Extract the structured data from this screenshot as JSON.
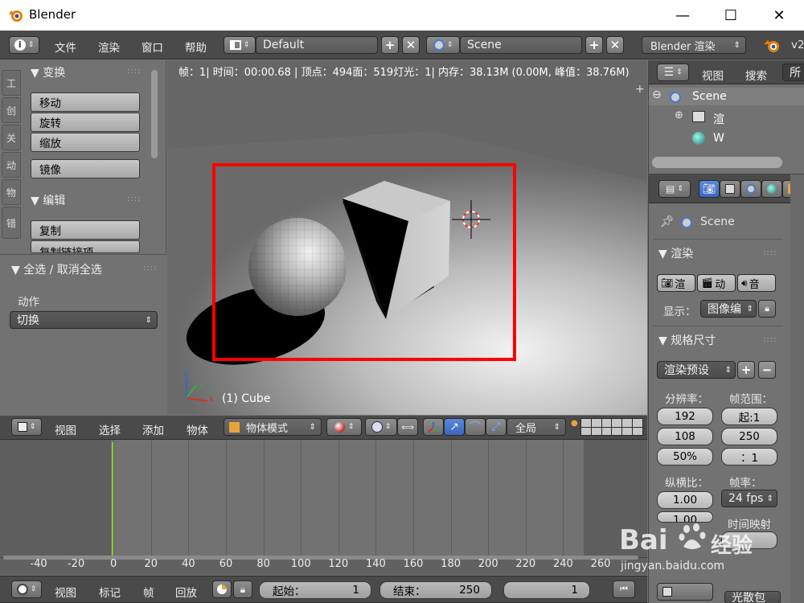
{
  "window": {
    "title": "Blender",
    "minimize": "—",
    "maximize": "☐",
    "close": "✕"
  },
  "infobar": {
    "menus": [
      "文件",
      "渲染",
      "窗口",
      "帮助"
    ],
    "layout": "Default",
    "scene": "Scene",
    "engine": "Blender 渲染",
    "version_fragment": "v2"
  },
  "viewport": {
    "stats": "帧：1| 时间：00:00.68 | 顶点：494面：519灯光：1| 内存：38.13M (0.00M, 峰值：38.76M)",
    "object_label": "(1) Cube",
    "axis_x": "x",
    "axis_y": "y",
    "axis_z": "z",
    "plus": "+"
  },
  "toolshelf": {
    "tabs": [
      "工",
      "创",
      "关",
      "动",
      "物",
      "错"
    ],
    "transform_title": "▼ 变换",
    "transform_buttons": [
      "移动",
      "旋转",
      "缩放"
    ],
    "mirror": "镜像",
    "edit_title": "▼ 编辑",
    "edit_buttons": [
      "复制",
      "复制链接项"
    ],
    "dots": "::::"
  },
  "operator": {
    "title": "▼ 全选 / 取消全选",
    "action_label": "动作",
    "action_value": "切换"
  },
  "view3d_header": {
    "menus": [
      "视图",
      "选择",
      "添加",
      "物体"
    ],
    "mode": "物体模式",
    "orientation": "全局"
  },
  "timeline": {
    "ticks": [
      "-40",
      "-20",
      "0",
      "20",
      "40",
      "60",
      "80",
      "100",
      "120",
      "140",
      "160",
      "180",
      "200",
      "220",
      "240",
      "260"
    ],
    "menus": [
      "视图",
      "标记",
      "帧",
      "回放"
    ],
    "start_label": "起始：",
    "start_value": "1",
    "end_label": "结束：",
    "end_value": "250",
    "current": "1"
  },
  "outliner": {
    "menus": [
      "视图",
      "搜索",
      "所"
    ],
    "scene": "Scene",
    "render_frag": "渲",
    "world_frag": "W",
    "expand": "⊖",
    "expand2": "⊕"
  },
  "properties": {
    "scene": "Scene",
    "render_title": "▼ 渲染",
    "render_btn": "渲",
    "anim_btn": "动",
    "audio_btn": "音",
    "display_label": "显示：",
    "display_value": "图像编",
    "dims_title": "▼ 规格尺寸",
    "preset": "渲染预设",
    "resolution_label": "分辨率：",
    "frame_range_label": "帧范围：",
    "res_x": "192",
    "res_y": "108",
    "res_pct": "50%",
    "start": "起:1",
    "end": "250",
    "step": "：1",
    "aspect_label": "纵横比：",
    "aspect_x": "1.00",
    "aspect_y": "1.00",
    "fps_label": "帧率：",
    "fps": "24 fps",
    "time_remap_label": "时间映射",
    "partial_label": "光散包",
    "plus": "+",
    "minus": "−"
  },
  "watermark": {
    "brand": "Bai",
    "brand_zh": "经验",
    "site": "jingyan.baidu.com"
  },
  "colors": {
    "accent_red": "#ff0000",
    "frame_green": "#7ed321",
    "header_bg": "#444444",
    "panel_bg": "#727272"
  }
}
